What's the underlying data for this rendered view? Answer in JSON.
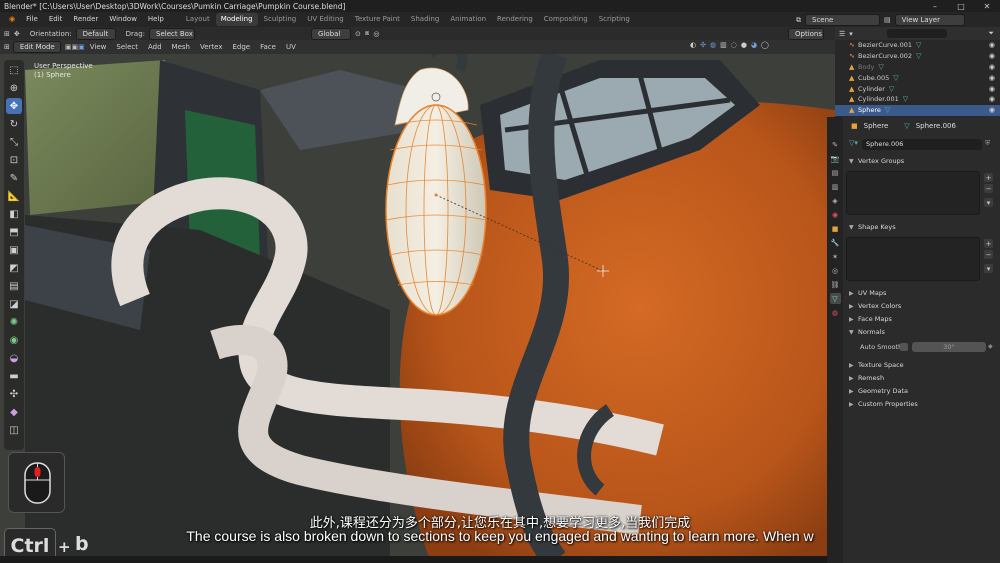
{
  "window": {
    "title": "Blender* [C:\\Users\\User\\Desktop\\3DWork\\Courses\\Pumkin Carriage\\Pumpkin Course.blend]"
  },
  "menu": [
    "File",
    "Edit",
    "Render",
    "Window",
    "Help"
  ],
  "workspaces": [
    "Layout",
    "Modeling",
    "Sculpting",
    "UV Editing",
    "Texture Paint",
    "Shading",
    "Animation",
    "Rendering",
    "Compositing",
    "Scripting"
  ],
  "active_workspace": "Modeling",
  "scene": {
    "scene_name": "Scene",
    "view_layer": "View Layer"
  },
  "tool_header": {
    "orientation_label": "Orientation:",
    "orientation_value": "Default",
    "drag_label": "Drag:",
    "drag_value": "Select Box",
    "transform_value": "Global",
    "options_label": "Options"
  },
  "viewport_header": {
    "mode": "Edit Mode",
    "menus": [
      "View",
      "Select",
      "Add",
      "Mesh",
      "Vertex",
      "Edge",
      "Face",
      "UV"
    ]
  },
  "viewport": {
    "perspective": "User Perspective",
    "object": "(1) Sphere"
  },
  "outliner": {
    "items": [
      {
        "name": "BezierCurve.001",
        "icon": "curve-icon",
        "selected": false,
        "dim": false
      },
      {
        "name": "BezierCurve.002",
        "icon": "curve-icon",
        "selected": false,
        "dim": false
      },
      {
        "name": "Body",
        "icon": "mesh-icon",
        "selected": false,
        "dim": true
      },
      {
        "name": "Cube.005",
        "icon": "mesh-icon",
        "selected": false,
        "dim": false
      },
      {
        "name": "Cylinder",
        "icon": "mesh-icon",
        "selected": false,
        "dim": false
      },
      {
        "name": "Cylinder.001",
        "icon": "mesh-icon",
        "selected": false,
        "dim": false
      },
      {
        "name": "Sphere",
        "icon": "mesh-icon",
        "selected": true,
        "dim": false
      }
    ]
  },
  "properties": {
    "object_name": "Sphere",
    "mesh_name": "Sphere.006",
    "mesh_field": "Sphere.006",
    "sections": {
      "vertex_groups": "Vertex Groups",
      "shape_keys": "Shape Keys",
      "uv_maps": "UV Maps",
      "vertex_colors": "Vertex Colors",
      "face_maps": "Face Maps",
      "normals": "Normals",
      "texture_space": "Texture Space",
      "remesh": "Remesh",
      "geometry_data": "Geometry Data",
      "custom_properties": "Custom Properties"
    },
    "auto_smooth_label": "Auto Smooth",
    "auto_smooth_angle": "30°"
  },
  "overlay": {
    "ctrl_key": "Ctrl",
    "plus": "+",
    "b_key": "b"
  },
  "subtitles": {
    "zh": "此外,课程还分为多个部分,让您乐在其中,想要学习更多,当我们完成",
    "en": "The course is also broken down to sections to keep you engaged and wanting to learn more. When w"
  },
  "colors": {
    "accent": "#4772b3",
    "pumpkin": "#c7601f",
    "selection": "#e8822a"
  }
}
